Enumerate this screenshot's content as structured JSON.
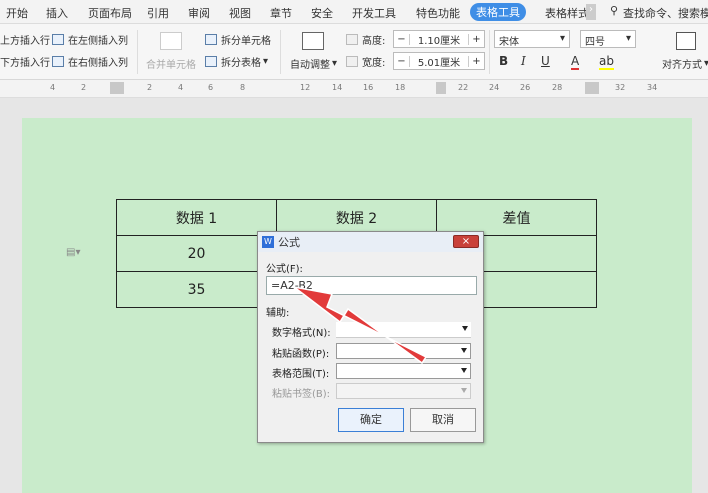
{
  "menubar": {
    "items": [
      "开始",
      "插入",
      "页面布局",
      "引用",
      "审阅",
      "视图",
      "章节",
      "安全",
      "开发工具",
      "特色功能",
      "表格工具",
      "表格样式"
    ],
    "active": "表格工具",
    "search_placeholder": "查找命令、搜索模板"
  },
  "ribbon": {
    "insert_above": "上方插入行",
    "insert_below": "下方插入行",
    "insert_left": "在左侧插入列",
    "insert_right": "在右侧插入列",
    "merge_cells": "合并单元格",
    "split_cells": "拆分单元格",
    "split_table": "拆分表格",
    "auto_fit": "自动调整",
    "height_label": "高度:",
    "height_value": "1.10厘米",
    "width_label": "宽度:",
    "width_value": "5.01厘米",
    "font_name": "宋体",
    "font_size": "四号",
    "bold": "B",
    "italic": "I",
    "underline": "U",
    "font_color": "A",
    "highlight": "ab",
    "align": "对齐方式"
  },
  "ruler": {
    "ticks": [
      "4",
      "2",
      "2",
      "4",
      "6",
      "8",
      "12",
      "14",
      "16",
      "18",
      "22",
      "24",
      "26",
      "28",
      "32",
      "34"
    ]
  },
  "table": {
    "rows": [
      [
        "数据 1",
        "数据 2",
        "差值"
      ],
      [
        "20",
        "",
        ""
      ],
      [
        "35",
        "",
        ""
      ]
    ]
  },
  "dialog": {
    "title": "公式",
    "close": "×",
    "formula_label": "公式(F):",
    "formula_value": "=A2-B2",
    "aux_label": "辅助:",
    "number_format": "数字格式(N):",
    "paste_function": "粘贴函数(P):",
    "table_range": "表格范围(T):",
    "paste_bookmark": "粘贴书签(B):",
    "ok": "确定",
    "cancel": "取消"
  },
  "colors": {
    "document_bg": "#c9ebcb",
    "arrow": "#e23a3a",
    "active_tab": "#3f8ee6"
  }
}
